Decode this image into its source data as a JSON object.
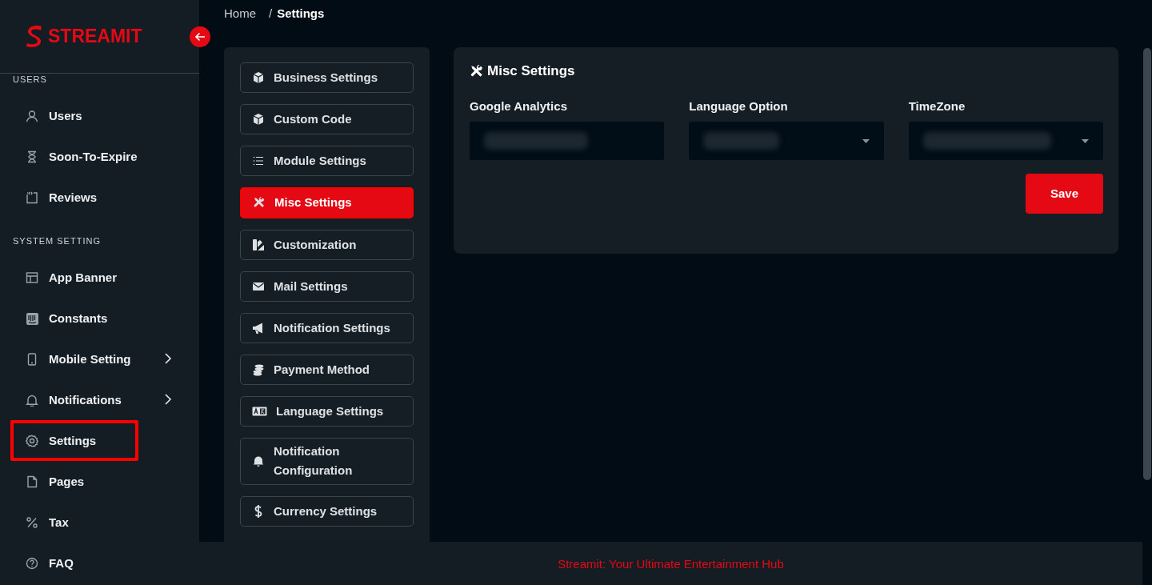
{
  "brand": {
    "name": "STREAMIT"
  },
  "sidebar": {
    "sections": [
      {
        "title": "USERS",
        "items": [
          {
            "label": "Users",
            "expandable": false,
            "highlighted": false
          },
          {
            "label": "Soon-To-Expire",
            "expandable": false,
            "highlighted": false
          },
          {
            "label": "Reviews",
            "expandable": false,
            "highlighted": false
          }
        ]
      },
      {
        "title": "SYSTEM SETTING",
        "items": [
          {
            "label": "App Banner",
            "expandable": false,
            "highlighted": false
          },
          {
            "label": "Constants",
            "expandable": false,
            "highlighted": false
          },
          {
            "label": "Mobile Setting",
            "expandable": true,
            "highlighted": false
          },
          {
            "label": "Notifications",
            "expandable": true,
            "highlighted": false
          },
          {
            "label": "Settings",
            "expandable": false,
            "highlighted": true
          },
          {
            "label": "Pages",
            "expandable": false,
            "highlighted": false
          },
          {
            "label": "Tax",
            "expandable": false,
            "highlighted": false
          },
          {
            "label": "FAQ",
            "expandable": false,
            "highlighted": false
          }
        ]
      }
    ]
  },
  "breadcrumb": {
    "separator": "/",
    "items": [
      "Home",
      "Settings"
    ]
  },
  "settings_nav": [
    {
      "label": "Business Settings",
      "selected": false
    },
    {
      "label": "Custom Code",
      "selected": false
    },
    {
      "label": "Module Settings",
      "selected": false
    },
    {
      "label": "Misc Settings",
      "selected": true
    },
    {
      "label": "Customization",
      "selected": false
    },
    {
      "label": "Mail Settings",
      "selected": false
    },
    {
      "label": "Notification Settings",
      "selected": false
    },
    {
      "label": "Payment Method",
      "selected": false
    },
    {
      "label": "Language Settings",
      "selected": false
    },
    {
      "label": "Notification Configuration",
      "selected": false
    },
    {
      "label": "Currency Settings",
      "selected": false
    }
  ],
  "card": {
    "title": "Misc Settings",
    "fields": [
      {
        "label": "Google Analytics",
        "kind": "input"
      },
      {
        "label": "Language Option",
        "kind": "select"
      },
      {
        "label": "TimeZone",
        "kind": "select"
      }
    ],
    "save_button": "Save"
  },
  "footer": {
    "text": "Streamit: Your Ultimate Entertainment Hub"
  }
}
